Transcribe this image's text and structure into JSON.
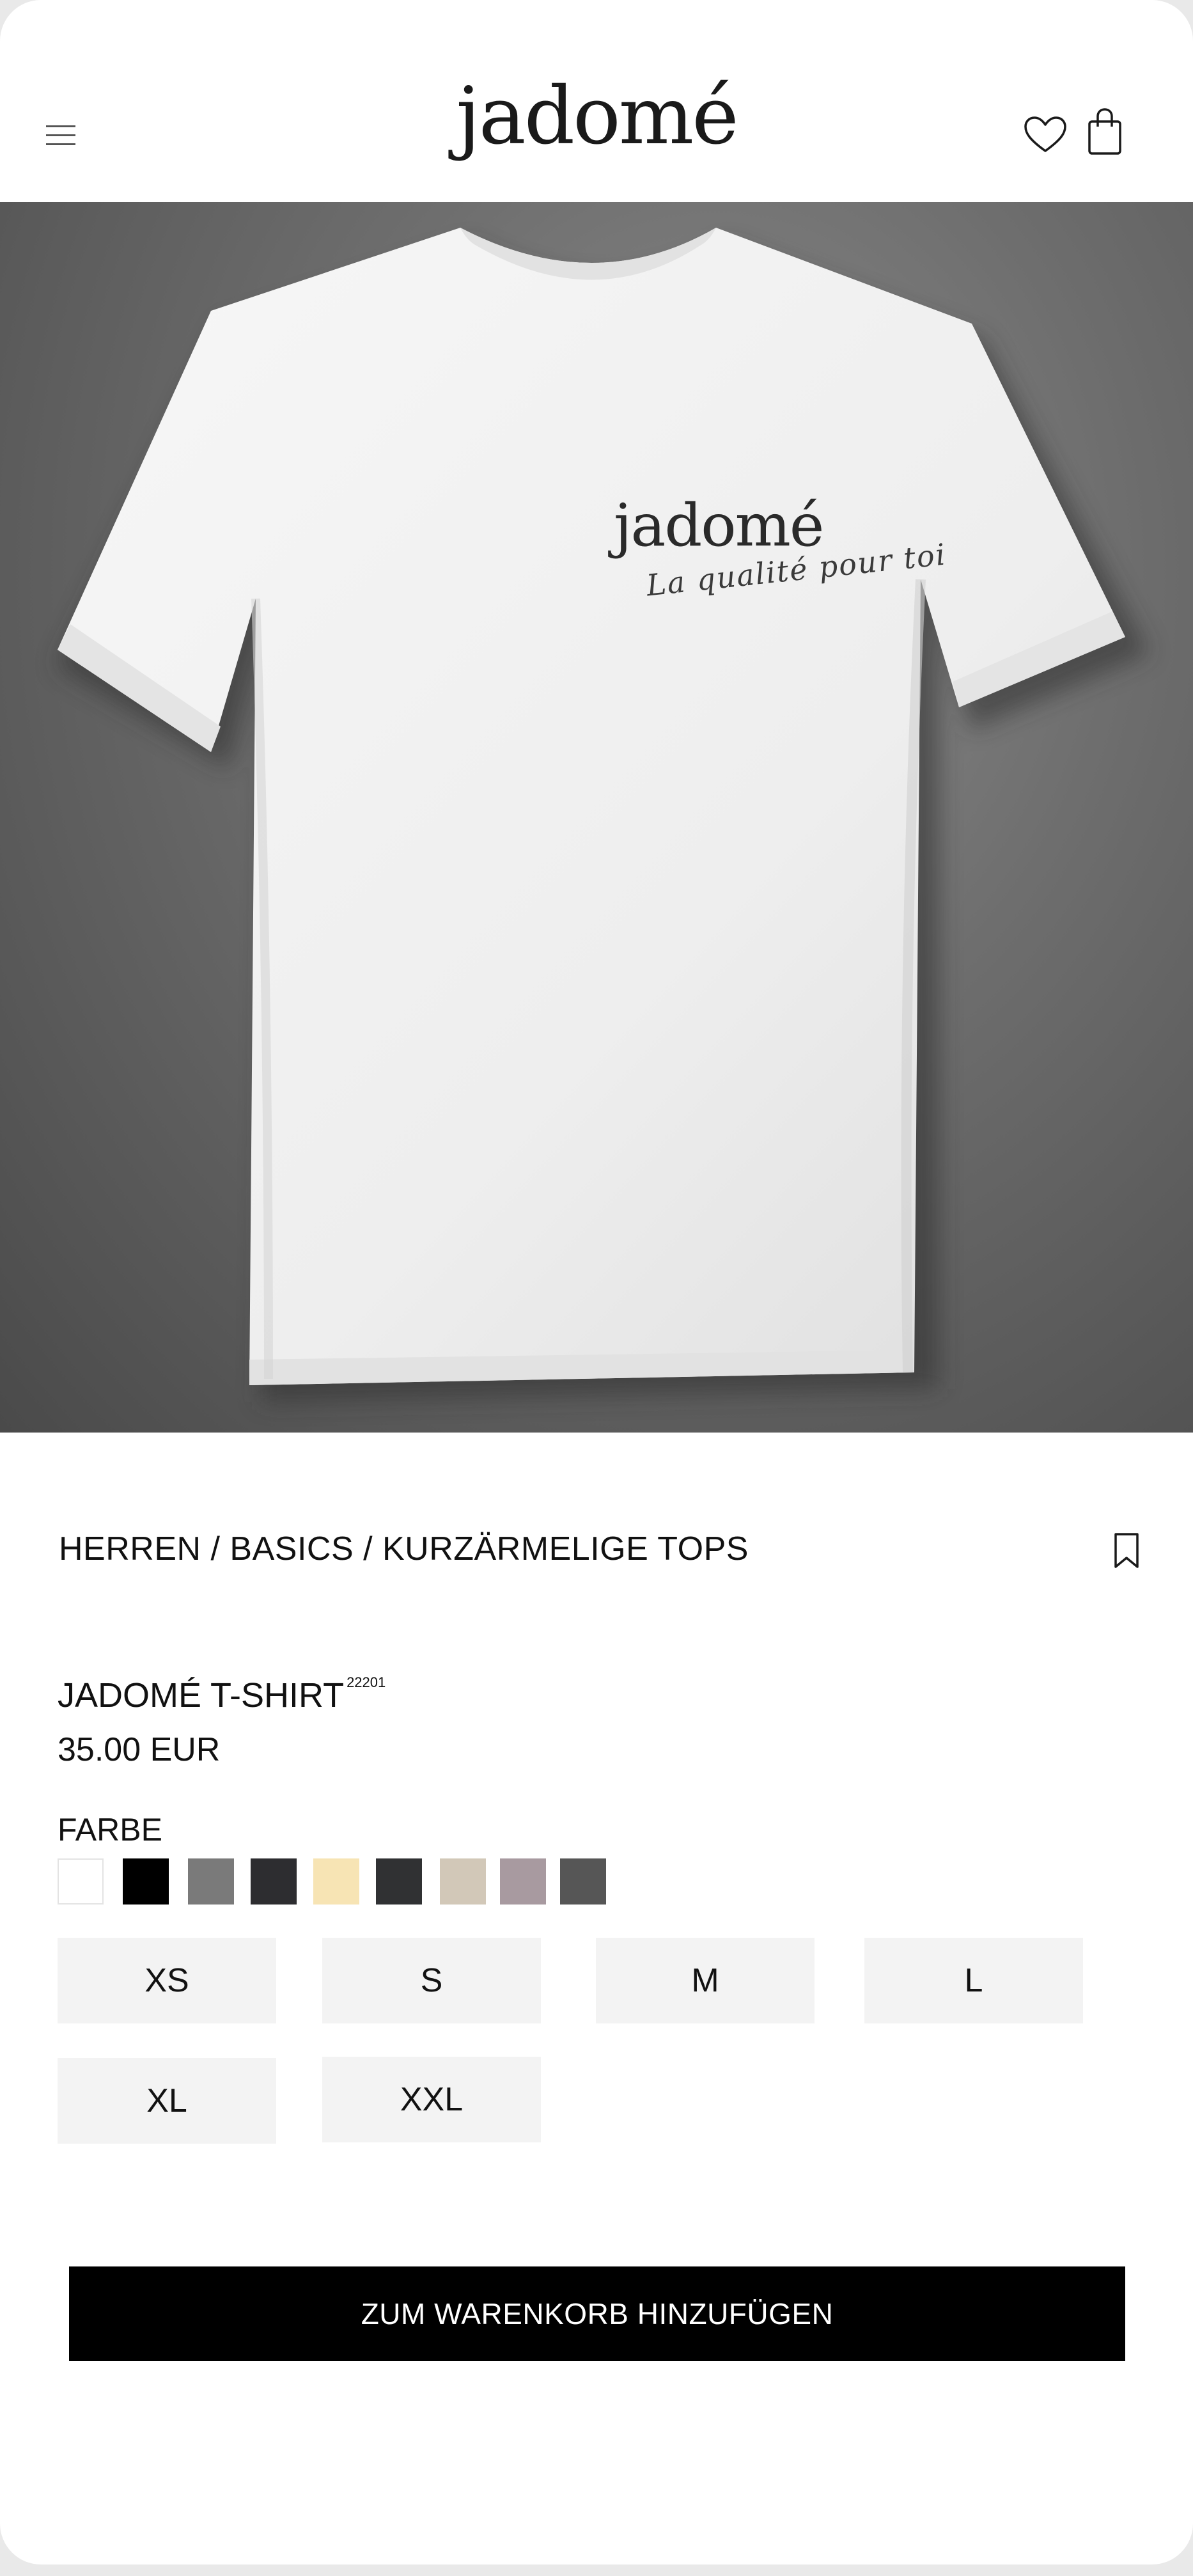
{
  "header": {
    "logo": "jadomé",
    "menu_icon": "hamburger-menu-icon",
    "favorite_icon": "heart-icon",
    "cart_icon": "shopping-bag-icon"
  },
  "product_image": {
    "print_logo": "jadomé",
    "print_tagline": "La qualité pour toi"
  },
  "breadcrumb": "HERREN / BASICS / KURZÄRMELIGE TOPS",
  "bookmark_icon": "bookmark-icon",
  "product": {
    "title": "JADOMÉ T-SHIRT",
    "sku": "22201",
    "price": "35.00 EUR"
  },
  "color_label": "FARBE",
  "colors": [
    "#ffffff",
    "#000000",
    "#7a7a7a",
    "#2d2d30",
    "#f7e4b4",
    "#303133",
    "#d2c8b8",
    "#a89aa0",
    "#565656"
  ],
  "sizes": [
    "XS",
    "S",
    "M",
    "L",
    "XL",
    "XXL"
  ],
  "cta_label": "ZUM WARENKORB HINZUFÜGEN"
}
